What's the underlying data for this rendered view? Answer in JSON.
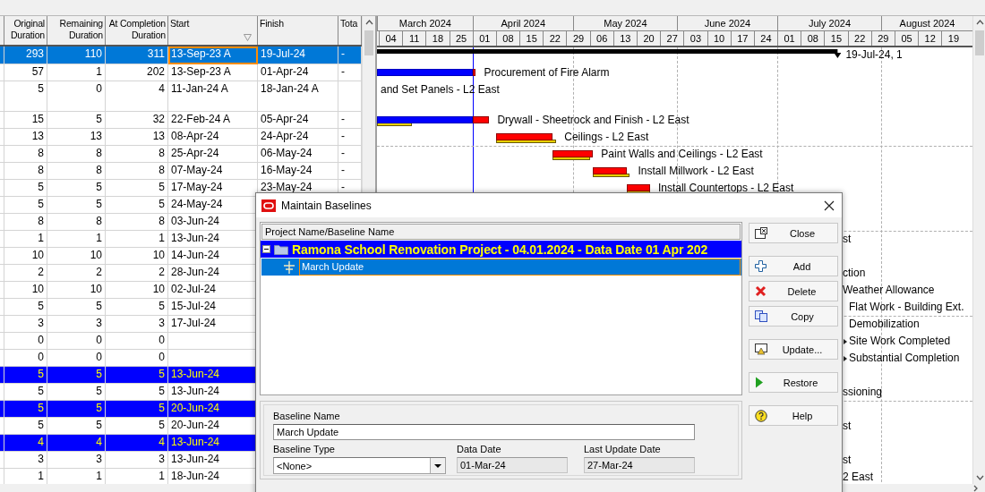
{
  "table": {
    "columns": [
      {
        "label": "Original Duration",
        "kind": "number",
        "filter": false
      },
      {
        "label": "Remaining Duration",
        "kind": "number",
        "filter": false
      },
      {
        "label": "At Completion Duration",
        "kind": "number",
        "filter": false
      },
      {
        "label": "Start",
        "kind": "date",
        "filter": true
      },
      {
        "label": "Finish",
        "kind": "date",
        "filter": false
      },
      {
        "label": "Tota",
        "kind": "date",
        "filter": false
      }
    ],
    "rows": [
      {
        "cells": [
          "293",
          "110",
          "311",
          "13-Sep-23 A",
          "19-Jul-24",
          "-"
        ],
        "selected": true,
        "kind": "activity",
        "focused": true,
        "wrapped": false,
        "gantt": {
          "kind": "summary",
          "label": "19-Jul-24, 1"
        }
      },
      {
        "cells": [
          "57",
          "1",
          "202",
          "13-Sep-23 A",
          "01-Apr-24",
          "-"
        ],
        "selected": false,
        "kind": "activity",
        "focused": false,
        "wrapped": false,
        "gantt": {
          "kind": "bar",
          "baseline": false,
          "label": "Procurement of Fire Alarm"
        }
      },
      {
        "cells": [
          "5",
          "0",
          "4",
          "11-Jan-24 A",
          "18-Jan-24 A"
        ],
        "selected": false,
        "kind": "activity",
        "focused": false,
        "wrapped": true,
        "gantt": {
          "kind": "text",
          "label": "and Set Panels - L2 East"
        }
      },
      {
        "cells": [
          "15",
          "5",
          "32",
          "22-Feb-24 A",
          "05-Apr-24",
          "-"
        ],
        "selected": false,
        "kind": "activity",
        "focused": false,
        "wrapped": false,
        "gantt": {
          "kind": "bar",
          "baseline": true,
          "label": "Drywall - Sheetrock and Finish - L2 East"
        }
      },
      {
        "cells": [
          "13",
          "13",
          "13",
          "08-Apr-24",
          "24-Apr-24",
          "-"
        ],
        "selected": false,
        "kind": "activity",
        "focused": false,
        "wrapped": false,
        "gantt": {
          "kind": "bar",
          "baseline": true,
          "label": "Ceilings - L2 East"
        }
      },
      {
        "cells": [
          "8",
          "8",
          "8",
          "25-Apr-24",
          "06-May-24",
          "-"
        ],
        "selected": false,
        "kind": "activity",
        "focused": false,
        "wrapped": false,
        "gantt": {
          "kind": "bar",
          "baseline": true,
          "label": "Paint Walls and Ceilings - L2 East"
        }
      },
      {
        "cells": [
          "8",
          "8",
          "8",
          "07-May-24",
          "16-May-24",
          "-"
        ],
        "selected": false,
        "kind": "activity",
        "focused": false,
        "wrapped": false,
        "gantt": {
          "kind": "bar",
          "baseline": true,
          "label": "Install Millwork - L2 East"
        }
      },
      {
        "cells": [
          "5",
          "5",
          "5",
          "17-May-24",
          "23-May-24",
          "-"
        ],
        "selected": false,
        "kind": "activity",
        "focused": false,
        "wrapped": false,
        "gantt": {
          "kind": "bar",
          "baseline": true,
          "label": "Install Countertops - L2 East"
        }
      },
      {
        "cells": [
          "5",
          "5",
          "5",
          "24-May-24"
        ],
        "selected": false,
        "kind": "activity",
        "focused": false,
        "wrapped": false
      },
      {
        "cells": [
          "8",
          "8",
          "8",
          "03-Jun-24"
        ],
        "selected": false,
        "kind": "activity",
        "focused": false,
        "wrapped": false
      },
      {
        "cells": [
          "1",
          "1",
          "1",
          "13-Jun-24"
        ],
        "selected": false,
        "kind": "activity",
        "focused": false,
        "wrapped": false,
        "gantt": {
          "kind": "clipped",
          "label": "st"
        }
      },
      {
        "cells": [
          "10",
          "10",
          "10",
          "14-Jun-24"
        ],
        "selected": false,
        "kind": "activity",
        "focused": false,
        "wrapped": false
      },
      {
        "cells": [
          "2",
          "2",
          "2",
          "28-Jun-24"
        ],
        "selected": false,
        "kind": "activity",
        "focused": false,
        "wrapped": false,
        "gantt": {
          "kind": "clipped",
          "label": "ction"
        }
      },
      {
        "cells": [
          "10",
          "10",
          "10",
          "02-Jul-24"
        ],
        "selected": false,
        "kind": "activity",
        "focused": false,
        "wrapped": false,
        "gantt": {
          "kind": "clipped",
          "label": "Weather Allowance"
        }
      },
      {
        "cells": [
          "5",
          "5",
          "5",
          "15-Jul-24"
        ],
        "selected": false,
        "kind": "activity",
        "focused": false,
        "wrapped": false,
        "gantt": {
          "kind": "trailing",
          "label": "Flat Work - Building Ext."
        }
      },
      {
        "cells": [
          "3",
          "3",
          "3",
          "17-Jul-24"
        ],
        "selected": false,
        "kind": "activity",
        "focused": false,
        "wrapped": false,
        "gantt": {
          "kind": "trailing",
          "label": "Demobilization"
        }
      },
      {
        "cells": [
          "0",
          "0",
          "0"
        ],
        "selected": false,
        "kind": "activity",
        "focused": false,
        "wrapped": false,
        "gantt": {
          "kind": "milestone",
          "label": "Site Work Completed"
        }
      },
      {
        "cells": [
          "0",
          "0",
          "0"
        ],
        "selected": false,
        "kind": "activity",
        "focused": false,
        "wrapped": false,
        "gantt": {
          "kind": "milestone",
          "label": "Substantial Completion"
        }
      },
      {
        "cells": [
          "5",
          "5",
          "5",
          "13-Jun-24"
        ],
        "selected": false,
        "kind": "wbs",
        "focused": false,
        "wrapped": false
      },
      {
        "cells": [
          "5",
          "5",
          "5",
          "13-Jun-24"
        ],
        "selected": false,
        "kind": "activity",
        "focused": false,
        "wrapped": false,
        "gantt": {
          "kind": "clipped",
          "label": "ssioning"
        }
      },
      {
        "cells": [
          "5",
          "5",
          "5",
          "20-Jun-24"
        ],
        "selected": false,
        "kind": "wbs",
        "focused": false,
        "wrapped": false
      },
      {
        "cells": [
          "5",
          "5",
          "5",
          "20-Jun-24"
        ],
        "selected": false,
        "kind": "activity",
        "focused": false,
        "wrapped": false,
        "gantt": {
          "kind": "clipped",
          "label": "st"
        }
      },
      {
        "cells": [
          "4",
          "4",
          "4",
          "13-Jun-24"
        ],
        "selected": false,
        "kind": "wbs",
        "focused": false,
        "wrapped": false
      },
      {
        "cells": [
          "3",
          "3",
          "3",
          "13-Jun-24"
        ],
        "selected": false,
        "kind": "activity",
        "focused": false,
        "wrapped": false,
        "gantt": {
          "kind": "clipped",
          "label": "st"
        }
      },
      {
        "cells": [
          "1",
          "1",
          "1",
          "18-Jun-24"
        ],
        "selected": false,
        "kind": "activity",
        "focused": false,
        "wrapped": false,
        "gantt": {
          "kind": "clipped",
          "label": "2 East"
        }
      }
    ]
  },
  "timeline": {
    "months": [
      "March 2024",
      "April 2024",
      "May 2024",
      "June 2024",
      "July 2024",
      "August 2024"
    ],
    "weeks": [
      "04",
      "11",
      "18",
      "25",
      "01",
      "08",
      "15",
      "22",
      "29",
      "06",
      "13",
      "20",
      "27",
      "03",
      "10",
      "17",
      "24",
      "01",
      "08",
      "15",
      "22",
      "29",
      "05",
      "12",
      "19"
    ]
  },
  "dialog": {
    "title": "Maintain Baselines",
    "tree_header": "Project Name/Baseline Name",
    "project": {
      "name": "Ramona School Renovation Project - 04.01.2024 - Data Date 01 Apr 202",
      "expanded": true,
      "selected": false
    },
    "baselines": [
      {
        "name": "March Update",
        "selected": true,
        "focused": true
      }
    ],
    "fields": [
      {
        "label": "Baseline Name",
        "value": "March Update",
        "kind": "text",
        "readonly": false
      },
      {
        "label": "Baseline Type",
        "value": "<None>",
        "kind": "dropdown"
      },
      {
        "label": "Data Date",
        "value": "01-Mar-24",
        "kind": "text",
        "readonly": true
      },
      {
        "label": "Last Update Date",
        "value": "27-Mar-24",
        "kind": "text",
        "readonly": true
      }
    ],
    "button_groups": [
      [
        {
          "label": "Close",
          "kind": "close"
        }
      ],
      [
        {
          "label": "Add",
          "kind": "add"
        },
        {
          "label": "Delete",
          "kind": "delete"
        },
        {
          "label": "Copy",
          "kind": "copy"
        }
      ],
      [
        {
          "label": "Update...",
          "kind": "update"
        }
      ],
      [
        {
          "label": "Restore",
          "kind": "restore"
        }
      ],
      [
        {
          "label": "Help",
          "kind": "help"
        }
      ]
    ]
  }
}
